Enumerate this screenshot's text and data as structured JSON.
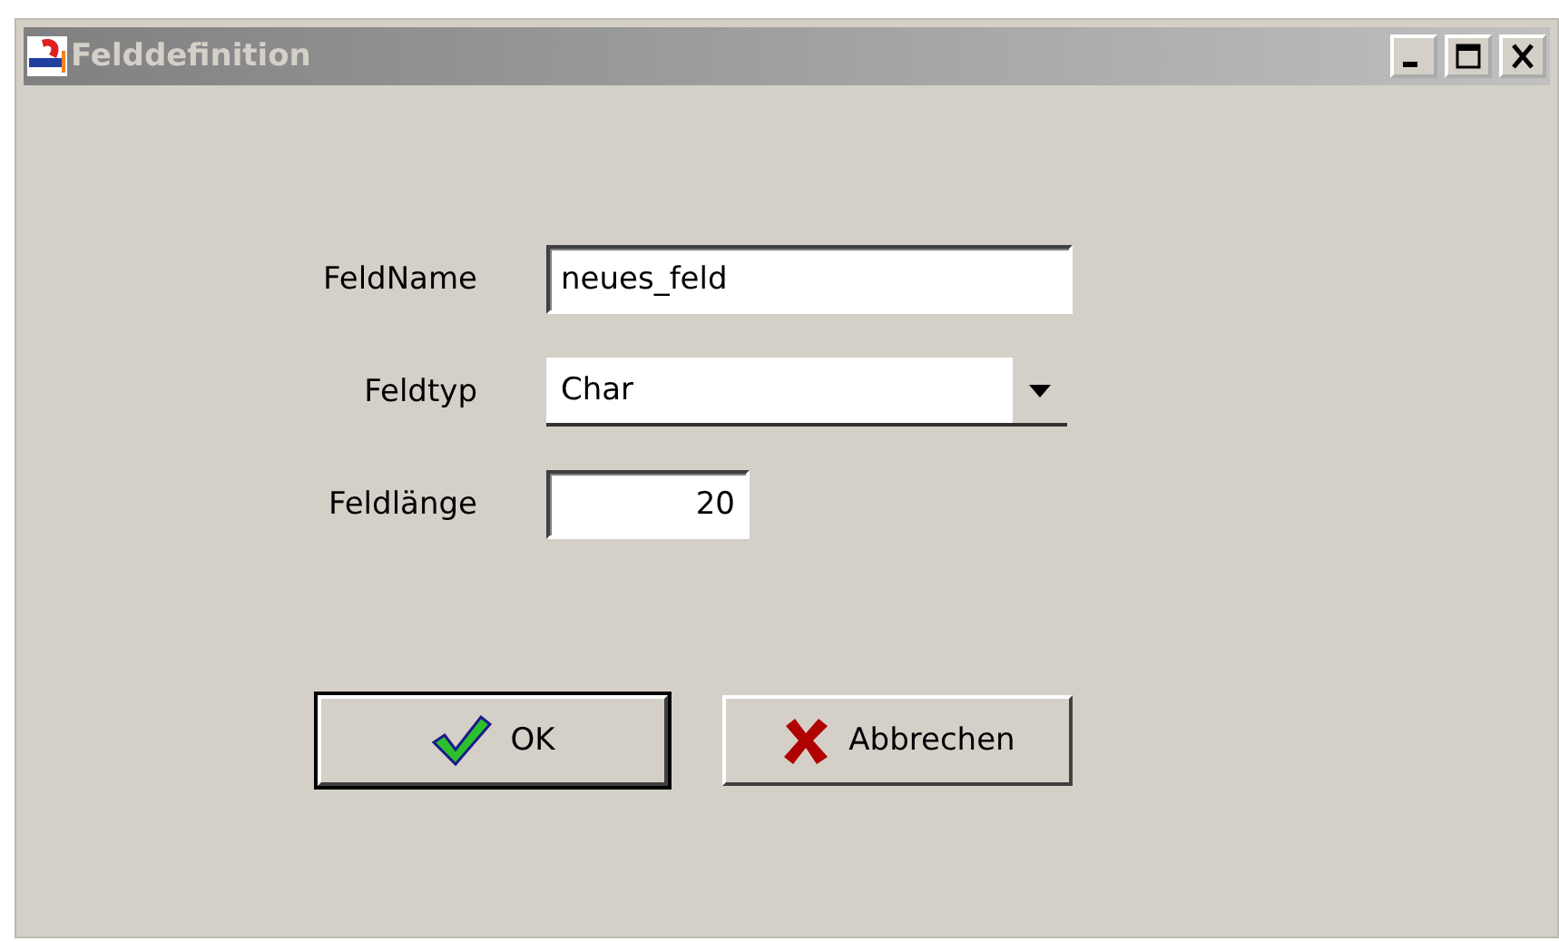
{
  "window": {
    "title": "Felddefinition",
    "active": false
  },
  "fields": [
    {
      "kind": "text",
      "label": "FeldName",
      "value": "neues_feld"
    },
    {
      "kind": "dropdown",
      "label": "Feldtyp",
      "value": "Char"
    },
    {
      "kind": "number",
      "label": "Feldlänge",
      "value": "20"
    }
  ],
  "buttons": [
    {
      "kind": "ok",
      "label": "OK",
      "default": true
    },
    {
      "kind": "cancel",
      "label": "Abbrechen",
      "default": false
    }
  ]
}
